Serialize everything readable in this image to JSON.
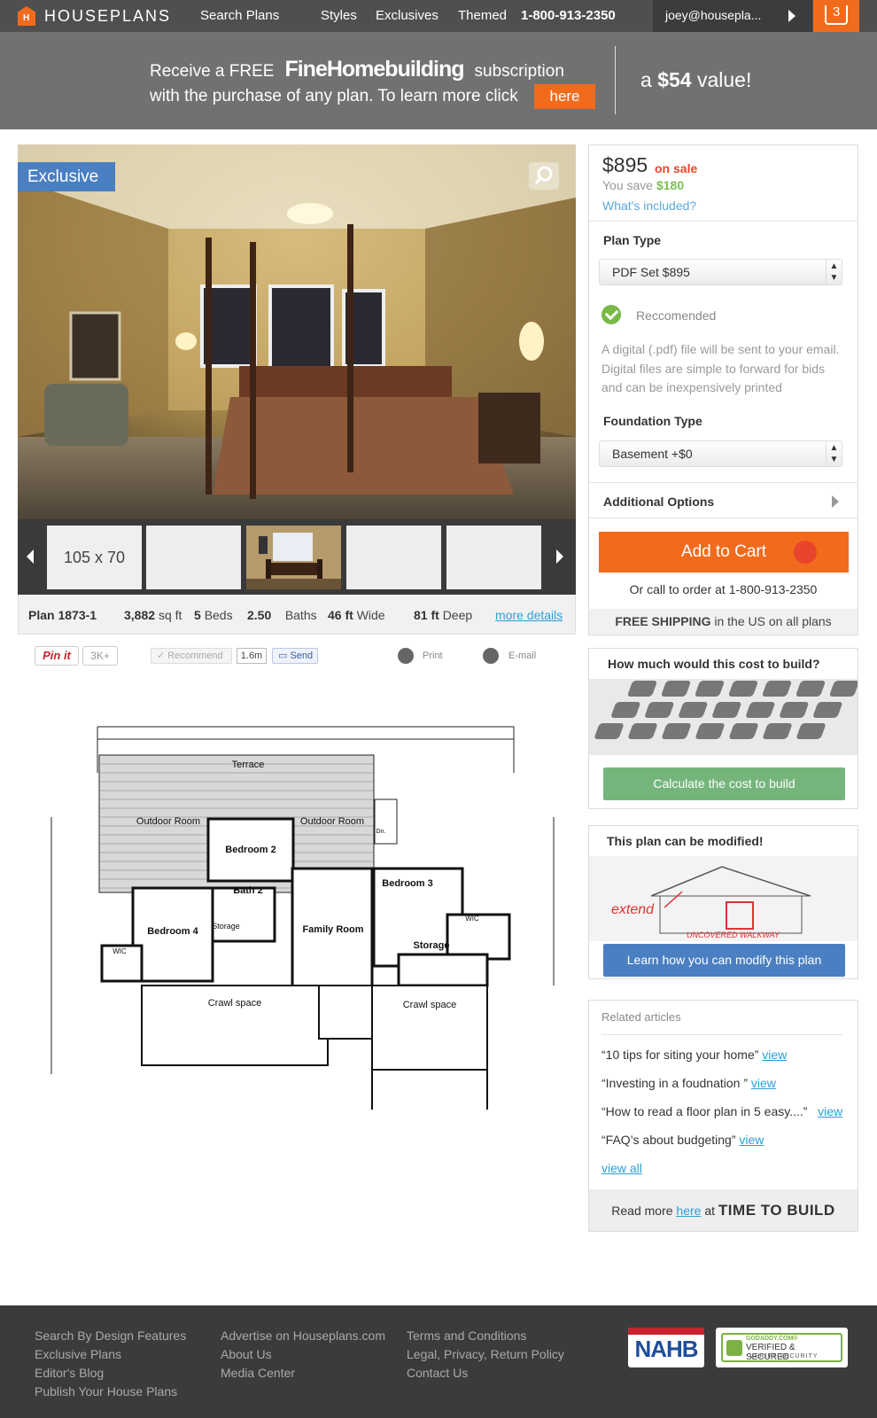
{
  "nav": {
    "logo_text": "HOUSEPLANS",
    "logo_letter": "H",
    "search": "Search Plans",
    "styles": "Styles",
    "exclusives": "Exclusives",
    "themed": "Themed",
    "phone": "1-800-913-2350",
    "user": "joey@housepla...",
    "cart_count": "3"
  },
  "promo": {
    "receive": "Receive a FREE",
    "brand": "FineHomebuilding",
    "subscription": "subscription",
    "line2": "with the purchase of any plan. To learn more click",
    "here": "here",
    "value_pre": "a",
    "value_amount": "$54",
    "value_post": "value!"
  },
  "gallery": {
    "badge": "Exclusive",
    "dimensions": "105 x 70"
  },
  "specs": {
    "plan": "Plan 1873-1",
    "sqft_num": "3,882",
    "sqft_unit": "sq ft",
    "beds_num": "5",
    "beds_unit": "Beds",
    "baths_num": "2.50",
    "baths_unit": "Baths",
    "wide_num": "46 ft",
    "wide_unit": "Wide",
    "deep_num": "81 ft",
    "deep_unit": "Deep",
    "more": "more details"
  },
  "share": {
    "pinit": "Pin it",
    "pin_count": "3K+",
    "recommend": "✓ Recommend",
    "recommend_count": "1.6m",
    "send": "Send",
    "print": "Print",
    "email": "E-mail"
  },
  "floorplan": {
    "rooms": [
      "Terrace",
      "Outdoor Room",
      "Outdoor Room",
      "Bedroom 2",
      "Bath 2",
      "Bedroom 3",
      "Bedroom 4",
      "Storage",
      "Family Room",
      "Storage",
      "WIC",
      "WIC",
      "Crawl space",
      "Crawl space",
      "Dn."
    ]
  },
  "purchase": {
    "price": "$895",
    "on_sale": "on sale",
    "save_label": "You save",
    "save_amount": "$180",
    "whats_included": "What's included?",
    "plan_type_label": "Plan Type",
    "plan_type_value": "PDF Set $895",
    "recommended": "Reccomended",
    "description": "A digital (.pdf) file will be sent to your email.  Digital files are simple to forward for bids and can be inexpensively printed",
    "foundation_label": "Foundation Type",
    "foundation_value": "Basement +$0",
    "additional_options": "Additional Options",
    "add_to_cart": "Add to Cart",
    "call_pre": "Or call to order at",
    "call_phone": "1-800-913-2350",
    "free_shipping": "FREE SHIPPING",
    "shipping_rest": "in the US on all plans"
  },
  "cost": {
    "title": "How much would this cost to build?",
    "button": "Calculate the cost to build"
  },
  "modify": {
    "title": "This plan can be modified!",
    "extend": "extend",
    "walkway": "UNCOVERED WALKWAY",
    "button": "Learn how you can modify this plan"
  },
  "related": {
    "title": "Related articles",
    "items": [
      {
        "text": "“10 tips for siting your home”",
        "link": "view"
      },
      {
        "text": "“Investing in a foudnation ”",
        "link": "view"
      },
      {
        "text": "“How to read a floor plan in 5 easy....”",
        "link": "view"
      },
      {
        "text": "“FAQ’s about budgeting”",
        "link": "view"
      }
    ],
    "view_all": "view all",
    "read_more_pre": "Read more",
    "read_more_here": "here",
    "read_more_at": "at",
    "time_to_build": "TIME TO BUILD"
  },
  "footer": {
    "col1": [
      "Search By Design Features",
      "Exclusive Plans",
      "Editor's Blog",
      "Publish Your House Plans"
    ],
    "col2": [
      "Advertise on Houseplans.com",
      "About Us",
      "Media Center"
    ],
    "col3": [
      "Terms and Conditions",
      "Legal, Privacy, Return Policy",
      "Contact Us"
    ],
    "nahb": "NAHB",
    "godaddy_top": "GODADDY.COM®",
    "godaddy_mid": "VERIFIED & SECURED",
    "godaddy_bot": "VERIFY SECURITY"
  },
  "colors": {
    "orange": "#f26b1d",
    "blue": "#4a7fc1",
    "green": "#75b57c",
    "nav": "#4f4f4f",
    "promo": "#717171"
  }
}
